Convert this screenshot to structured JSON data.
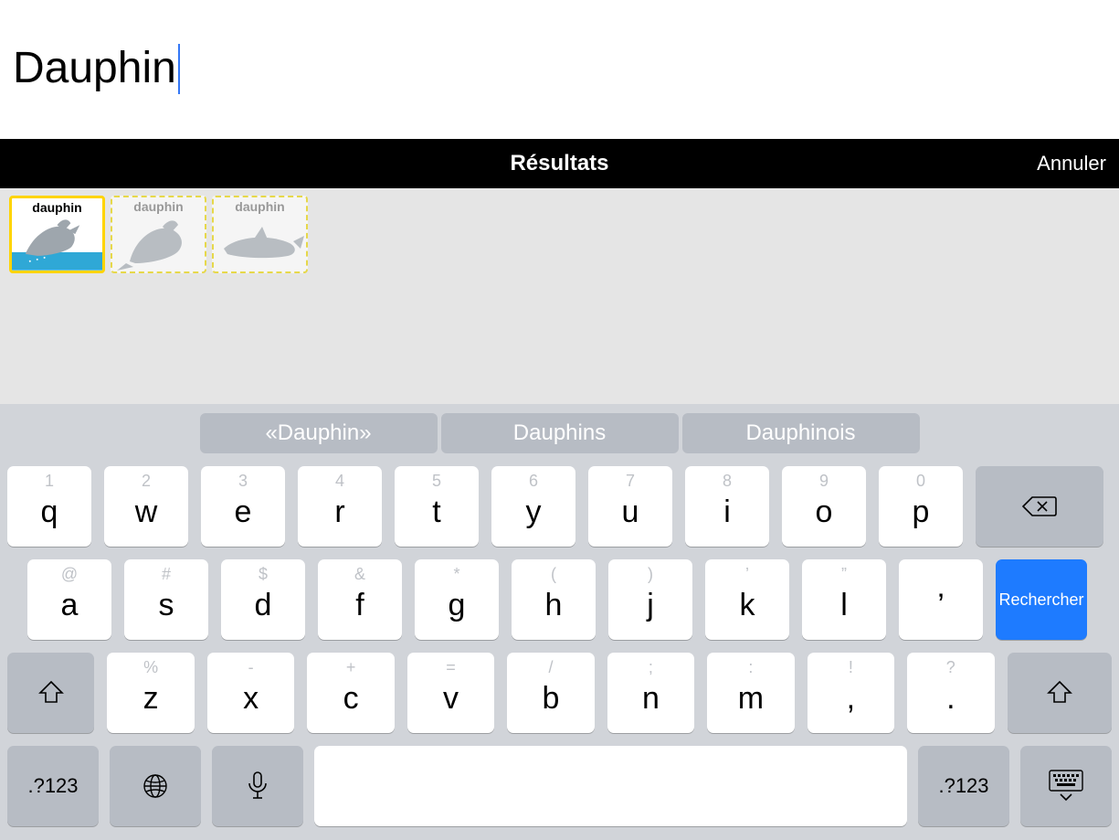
{
  "search": {
    "text": "Dauphin"
  },
  "results_bar": {
    "title": "Résultats",
    "cancel": "Annuler"
  },
  "results": [
    {
      "label": "dauphin",
      "selected": true,
      "variant": "jumping-color"
    },
    {
      "label": "dauphin",
      "selected": false,
      "variant": "jumping-grey"
    },
    {
      "label": "dauphin",
      "selected": false,
      "variant": "swimming-grey"
    }
  ],
  "keyboard": {
    "suggestions": [
      "«Dauphin»",
      "Dauphins",
      "Dauphinois"
    ],
    "row1": [
      {
        "k": "q",
        "n": "1"
      },
      {
        "k": "w",
        "n": "2"
      },
      {
        "k": "e",
        "n": "3"
      },
      {
        "k": "r",
        "n": "4"
      },
      {
        "k": "t",
        "n": "5"
      },
      {
        "k": "y",
        "n": "6"
      },
      {
        "k": "u",
        "n": "7"
      },
      {
        "k": "i",
        "n": "8"
      },
      {
        "k": "o",
        "n": "9"
      },
      {
        "k": "p",
        "n": "0"
      }
    ],
    "row2": [
      {
        "k": "a",
        "n": "@"
      },
      {
        "k": "s",
        "n": "#"
      },
      {
        "k": "d",
        "n": "$"
      },
      {
        "k": "f",
        "n": "&"
      },
      {
        "k": "g",
        "n": "*"
      },
      {
        "k": "h",
        "n": "("
      },
      {
        "k": "j",
        "n": ")"
      },
      {
        "k": "k",
        "n": "’"
      },
      {
        "k": "l",
        "n": "”"
      }
    ],
    "apostrophe": "’",
    "search_label": "Rechercher",
    "row3": [
      {
        "k": "z",
        "n": "%"
      },
      {
        "k": "x",
        "n": "-"
      },
      {
        "k": "c",
        "n": "+"
      },
      {
        "k": "v",
        "n": "="
      },
      {
        "k": "b",
        "n": "/"
      },
      {
        "k": "n",
        "n": ";"
      },
      {
        "k": "m",
        "n": ":"
      }
    ],
    "punct1": {
      "k": ",",
      "n": "!"
    },
    "punct2": {
      "k": ".",
      "n": "?"
    },
    "numsym": ".?123"
  }
}
